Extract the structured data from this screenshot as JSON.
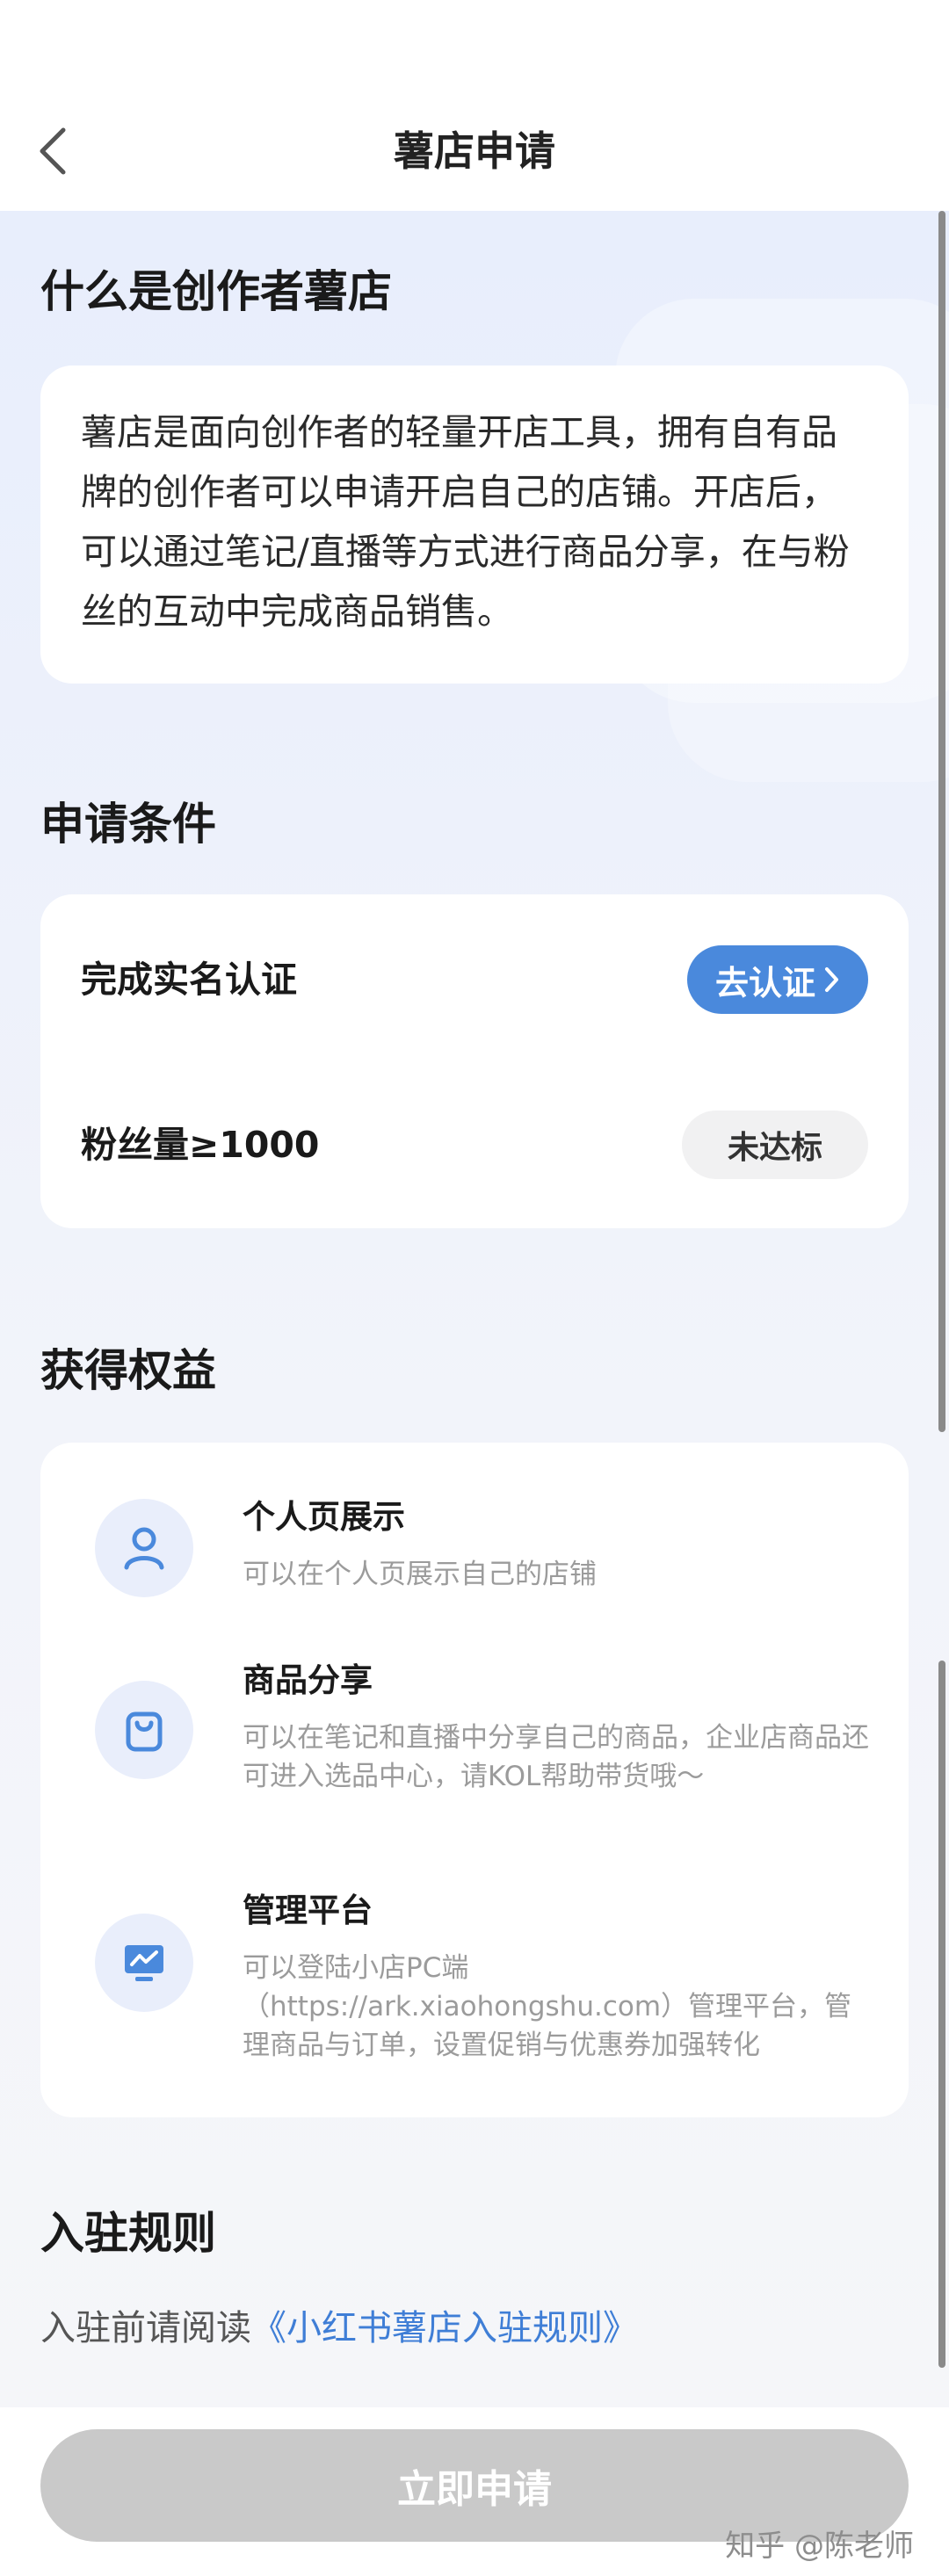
{
  "header": {
    "title": "薯店申请",
    "back_icon": "chevron-left-icon"
  },
  "intro": {
    "title": "什么是创作者薯店",
    "text": "薯店是面向创作者的轻量开店工具，拥有自有品牌的创作者可以申请开启自己的店铺。开店后，可以通过笔记/直播等方式进行商品分享，在与粉丝的互动中完成商品销售。"
  },
  "conditions": {
    "title": "申请条件",
    "items": [
      {
        "label": "完成实名认证",
        "action_label": "去认证",
        "action_icon": "chevron-right-icon"
      },
      {
        "label": "粉丝量≥1000",
        "status": "未达标"
      }
    ]
  },
  "benefits": {
    "title": "获得权益",
    "items": [
      {
        "icon": "user-icon",
        "title": "个人页展示",
        "desc": "可以在个人页展示自己的店铺"
      },
      {
        "icon": "shopping-bag-icon",
        "title": "商品分享",
        "desc": "可以在笔记和直播中分享自己的商品，企业店商品还可进入选品中心，请KOL帮助带货哦～"
      },
      {
        "icon": "monitor-chart-icon",
        "title": "管理平台",
        "desc": "可以登陆小店PC端（https://ark.xiaohongshu.com）管理平台，管理商品与订单，设置促销与优惠券加强转化"
      }
    ]
  },
  "rules": {
    "title": "入驻规则",
    "prefix": "入驻前请阅读",
    "link": "《小红书薯店入驻规则》"
  },
  "footer": {
    "apply_label": "立即申请",
    "watermark": "知乎 @陈老师"
  },
  "colors": {
    "accent": "#4a89dc",
    "link": "#3f7ed6",
    "disabled": "#c9c9c9"
  }
}
